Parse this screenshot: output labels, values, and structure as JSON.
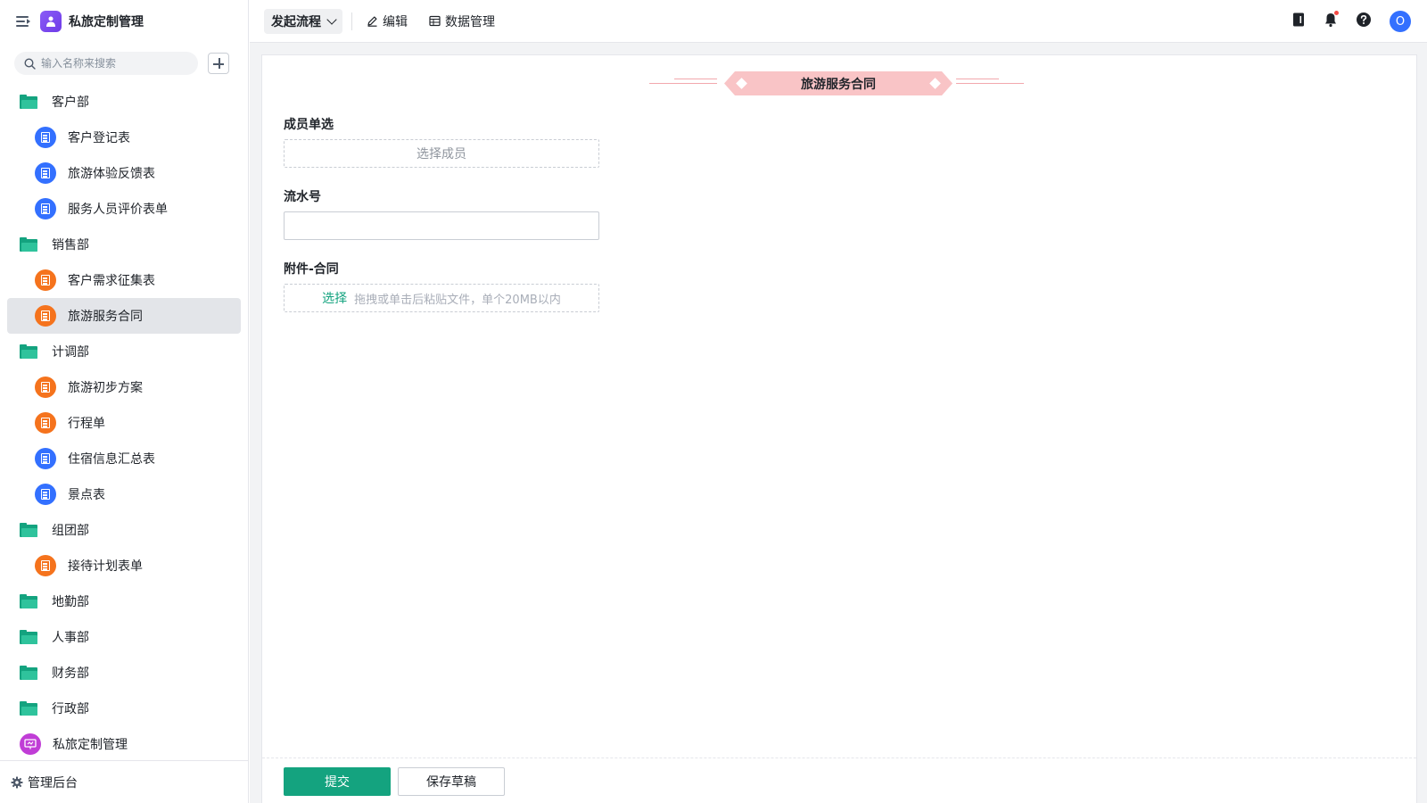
{
  "app": {
    "title": "私旅定制管理"
  },
  "search": {
    "placeholder": "输入名称来搜索"
  },
  "sidebar": {
    "items": [
      {
        "type": "folder",
        "label": "客户部"
      },
      {
        "type": "form",
        "label": "客户登记表",
        "color": "#3370ff",
        "icon": "document-icon"
      },
      {
        "type": "form",
        "label": "旅游体验反馈表",
        "color": "#3370ff",
        "icon": "document-icon"
      },
      {
        "type": "form",
        "label": "服务人员评价表单",
        "color": "#3370ff",
        "icon": "document-icon"
      },
      {
        "type": "folder",
        "label": "销售部"
      },
      {
        "type": "form",
        "label": "客户需求征集表",
        "color": "#f5731d",
        "icon": "flow-document-icon"
      },
      {
        "type": "form",
        "label": "旅游服务合同",
        "color": "#f5731d",
        "icon": "flow-document-icon",
        "active": true
      },
      {
        "type": "folder",
        "label": "计调部"
      },
      {
        "type": "form",
        "label": "旅游初步方案",
        "color": "#f5731d",
        "icon": "flow-document-icon"
      },
      {
        "type": "form",
        "label": "行程单",
        "color": "#f5731d",
        "icon": "document-icon"
      },
      {
        "type": "form",
        "label": "住宿信息汇总表",
        "color": "#3370ff",
        "icon": "document-icon"
      },
      {
        "type": "form",
        "label": "景点表",
        "color": "#3370ff",
        "icon": "document-icon"
      },
      {
        "type": "folder",
        "label": "组团部"
      },
      {
        "type": "form",
        "label": "接待计划表单",
        "color": "#f5731d",
        "icon": "flow-document-icon"
      },
      {
        "type": "folder",
        "label": "地勤部"
      },
      {
        "type": "folder",
        "label": "人事部"
      },
      {
        "type": "folder",
        "label": "财务部"
      },
      {
        "type": "folder",
        "label": "行政部"
      },
      {
        "type": "app",
        "label": "私旅定制管理",
        "color": "#c03dd6",
        "icon": "dashboard-icon"
      }
    ],
    "footer": "管理后台"
  },
  "toolbar": {
    "launch": "发起流程",
    "edit": "编辑",
    "data_manage": "数据管理"
  },
  "user": {
    "avatar_letter": "O"
  },
  "form": {
    "title": "旅游服务合同",
    "fields": {
      "member": {
        "label": "成员单选",
        "placeholder": "选择成员"
      },
      "serial": {
        "label": "流水号",
        "value": ""
      },
      "attachment": {
        "label": "附件-合同",
        "pick": "选择",
        "hint": "拖拽或单击后粘贴文件，单个20MB以内"
      }
    },
    "submit": "提交",
    "save_draft": "保存草稿"
  },
  "colors": {
    "accent": "#14a37f",
    "brand": "#3370ff",
    "title_band": "#f9c4c6"
  }
}
